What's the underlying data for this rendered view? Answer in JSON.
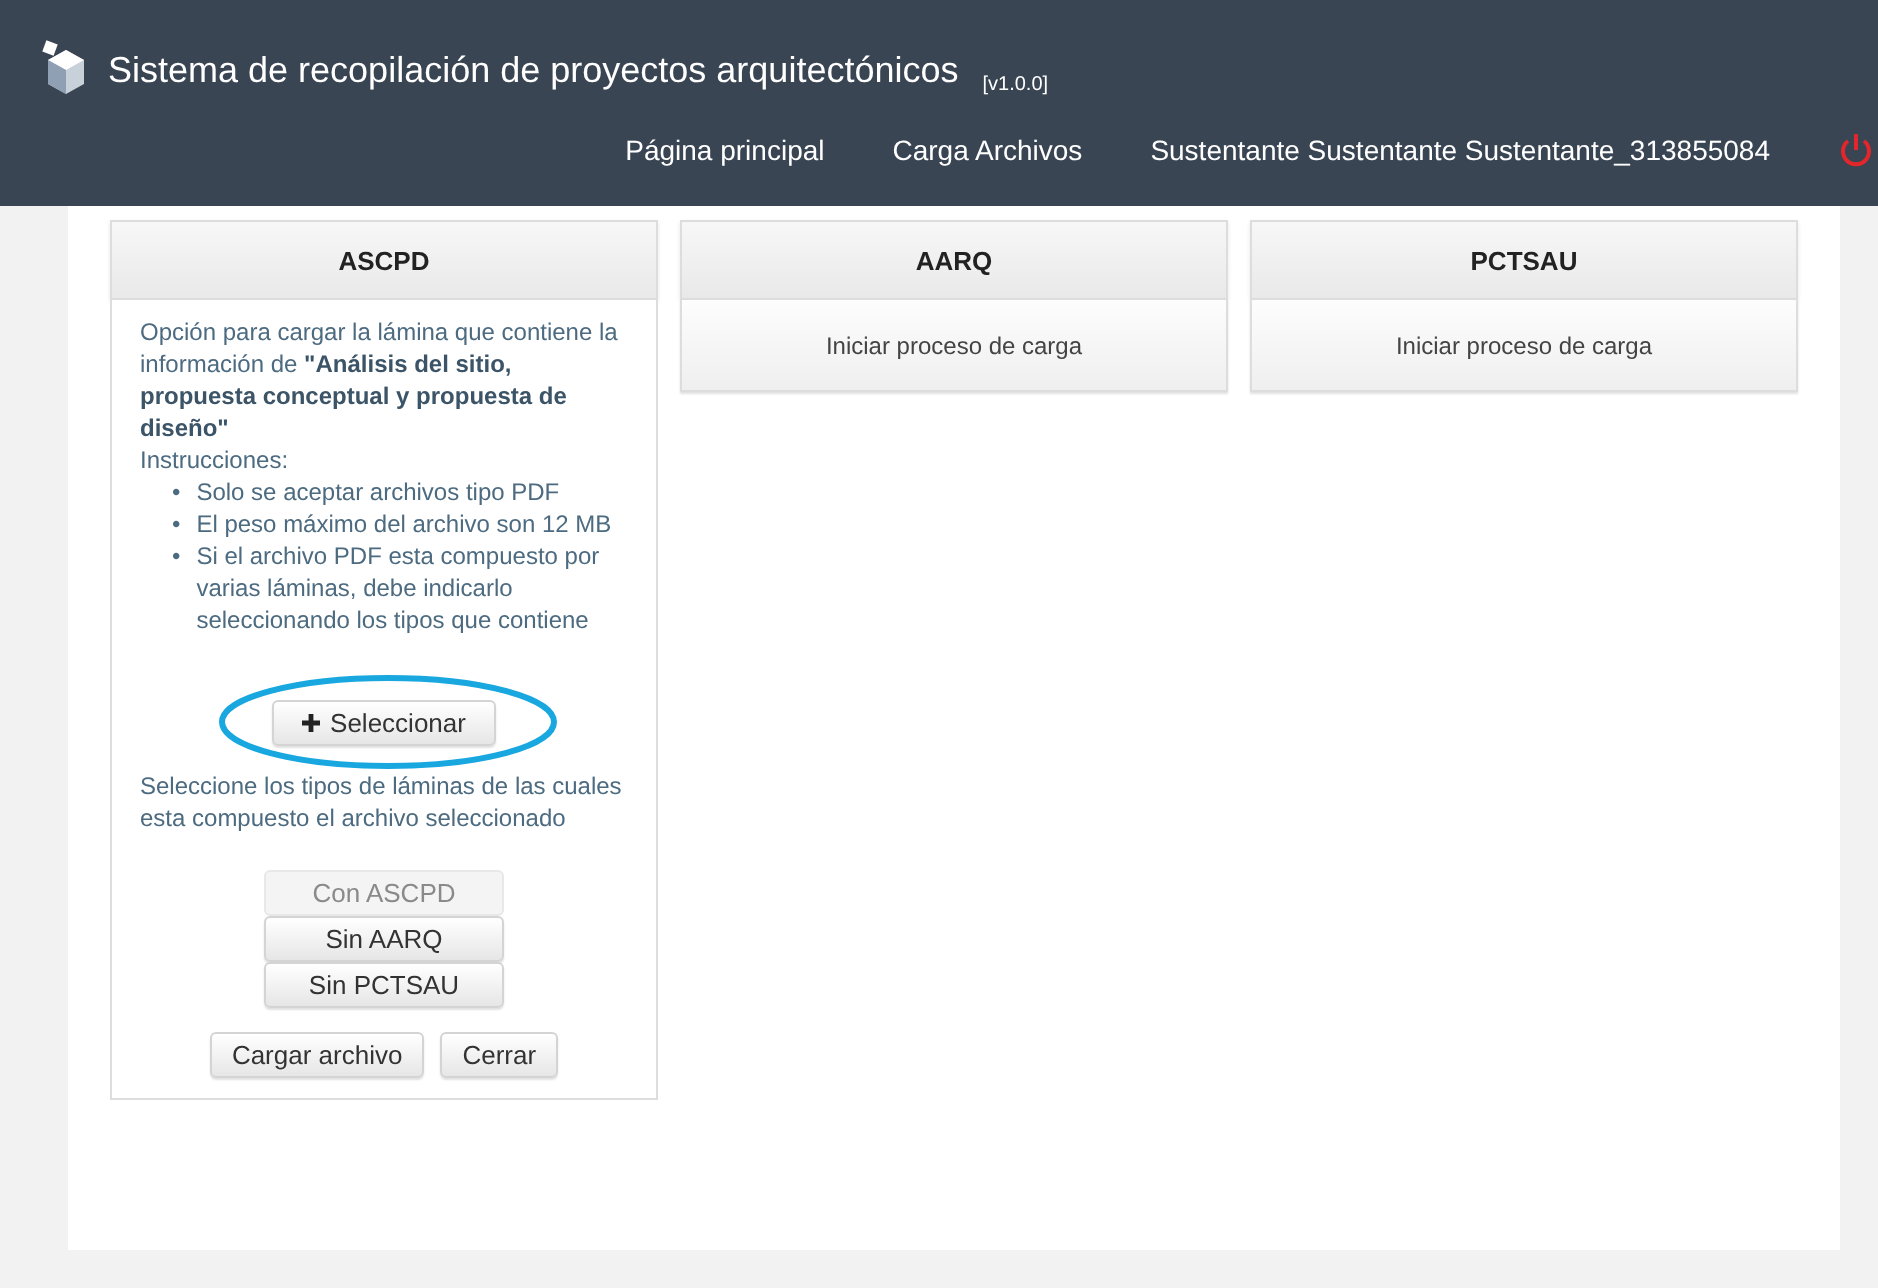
{
  "header": {
    "title": "Sistema de recopilación de proyectos arquitectónicos",
    "version": "[v1.0.0]",
    "nav": [
      "Página principal",
      "Carga Archivos"
    ],
    "user": "Sustentante Sustentante Sustentante_313855084"
  },
  "cards": [
    {
      "kind": "expanded",
      "title": "ASCPD",
      "description": "Opción para cargar la lámina que contiene la información de **\"Análisis del sitio, propuesta conceptual y propuesta de diseño\"**",
      "instructions_label": "Instrucciones:",
      "instructions": [
        {
          "marker": "•",
          "text": "Solo se aceptar archivos tipo PDF"
        },
        {
          "marker": "•",
          "text": "El peso máximo del archivo son 12 MB"
        },
        {
          "marker": "•",
          "text": "Si el archivo PDF esta compuesto por varias láminas, debe indicarlo seleccionando los tipos que contiene"
        }
      ],
      "select_button": "Seleccionar",
      "types_prompt": "Seleccione los tipos de láminas de las cuales esta compuesto el archivo seleccionado",
      "type_buttons": [
        {
          "label": "Con ASCPD",
          "disabled": true
        },
        {
          "label": "Sin AARQ",
          "disabled": false
        },
        {
          "label": "Sin PCTSAU",
          "disabled": false
        }
      ],
      "actions": [
        "Cargar archivo",
        "Cerrar"
      ]
    },
    {
      "kind": "collapsed",
      "title": "AARQ",
      "action": "Iniciar proceso de carga"
    },
    {
      "kind": "collapsed",
      "title": "PCTSAU",
      "action": "Iniciar proceso de carga"
    }
  ]
}
